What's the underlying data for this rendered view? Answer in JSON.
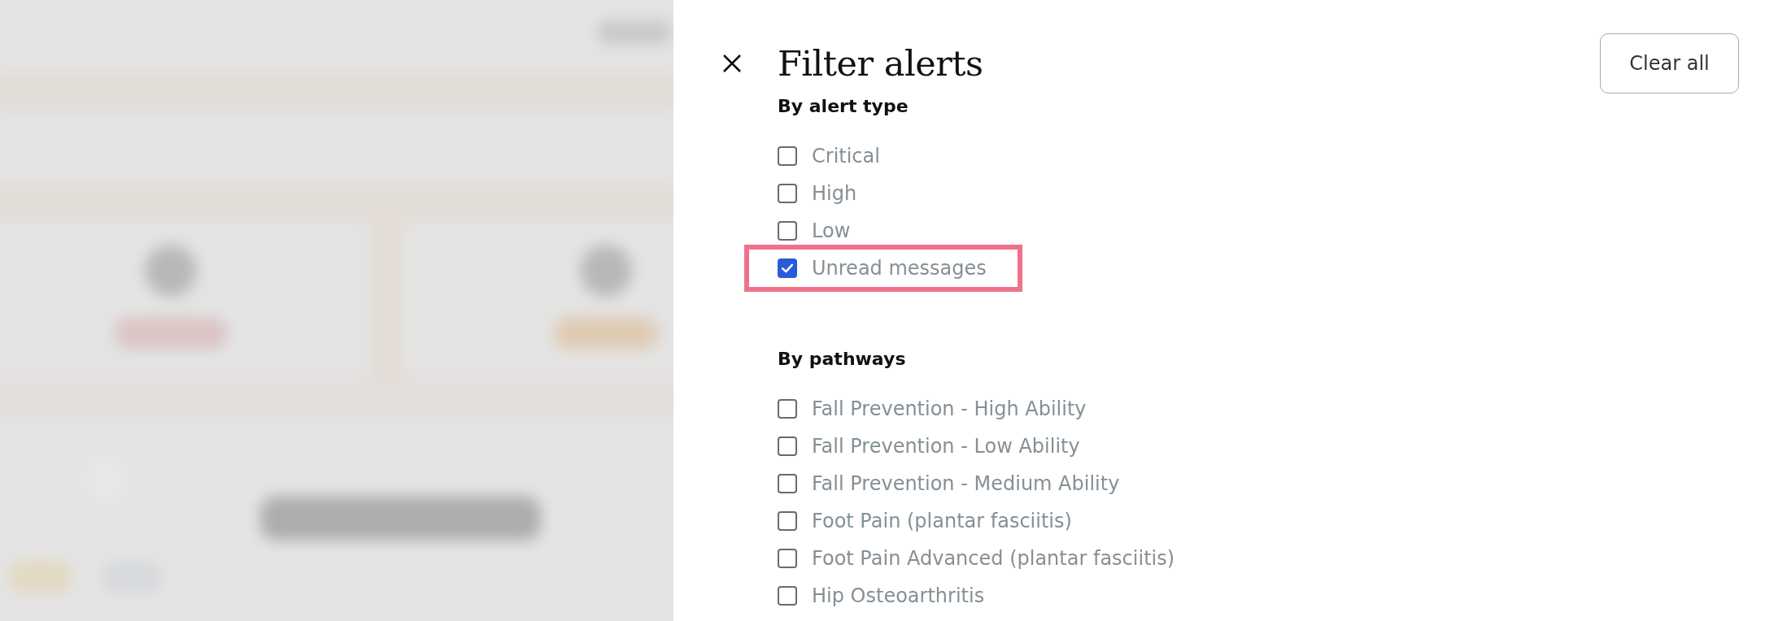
{
  "drawer": {
    "title": "Filter alerts",
    "clear_button": "Clear all"
  },
  "sections": [
    {
      "heading": "By alert type",
      "options": [
        {
          "label": "Critical",
          "checked": false,
          "highlighted": false
        },
        {
          "label": "High",
          "checked": false,
          "highlighted": false
        },
        {
          "label": "Low",
          "checked": false,
          "highlighted": false
        },
        {
          "label": "Unread messages",
          "checked": true,
          "highlighted": true
        }
      ]
    },
    {
      "heading": "By pathways",
      "options": [
        {
          "label": "Fall Prevention - High Ability",
          "checked": false,
          "highlighted": false
        },
        {
          "label": "Fall Prevention - Low Ability",
          "checked": false,
          "highlighted": false
        },
        {
          "label": "Fall Prevention - Medium Ability",
          "checked": false,
          "highlighted": false
        },
        {
          "label": "Foot Pain (plantar fasciitis)",
          "checked": false,
          "highlighted": false
        },
        {
          "label": "Foot Pain Advanced (plantar fasciitis)",
          "checked": false,
          "highlighted": false
        },
        {
          "label": "Hip Osteoarthritis",
          "checked": false,
          "highlighted": false
        }
      ]
    }
  ]
}
